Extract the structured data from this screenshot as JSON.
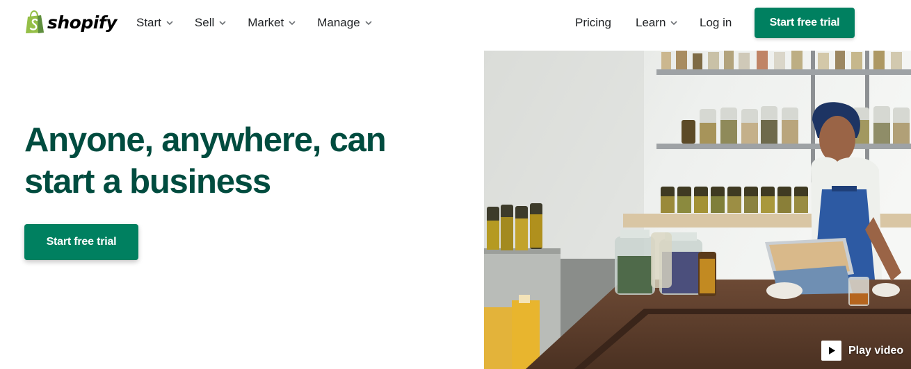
{
  "brand": {
    "name": "shopify",
    "color": "#95bf47"
  },
  "nav": {
    "left_items": [
      {
        "label": "Start"
      },
      {
        "label": "Sell"
      },
      {
        "label": "Market"
      },
      {
        "label": "Manage"
      }
    ],
    "pricing": "Pricing",
    "learn": "Learn",
    "login": "Log in",
    "cta": "Start free trial"
  },
  "hero": {
    "title": "Anyone, anywhere, can start a business",
    "cta": "Start free trial",
    "image_alt_name": "shop-owner-herbs-photo"
  },
  "video": {
    "label": "Play video"
  },
  "colors": {
    "primary": "#008060",
    "heading": "#004c3f",
    "text": "#212326"
  }
}
